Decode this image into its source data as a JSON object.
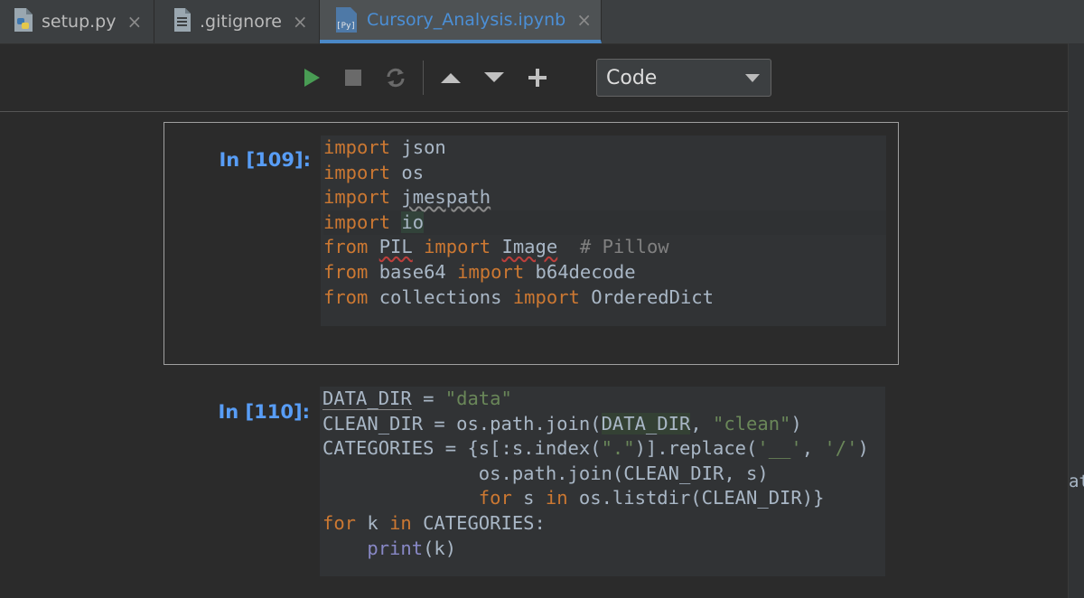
{
  "tabs": [
    {
      "label": "setup.py",
      "icon": "python-file-icon",
      "close": "×",
      "active": false
    },
    {
      "label": ".gitignore",
      "icon": "text-file-icon",
      "close": "×",
      "active": false
    },
    {
      "label": "Cursory_Analysis.ipynb",
      "icon": "notebook-file-icon",
      "icon_text": "[Py]",
      "close": "×",
      "active": true
    }
  ],
  "toolbar": {
    "cell_type": "Code",
    "buttons": [
      "run-cell-icon",
      "stop-icon",
      "restart-kernel-icon",
      "move-up-icon",
      "move-down-icon",
      "add-cell-icon"
    ],
    "run_color": "#499c54"
  },
  "cells": [
    {
      "prompt": "In [109]:",
      "lines": [
        "import json",
        "import os",
        "import jmespath",
        "import io",
        "from PIL import Image  # Pillow",
        "from base64 import b64decode",
        "from collections import OrderedDict"
      ]
    },
    {
      "prompt": "In [110]:",
      "lines": [
        "DATA_DIR = \"data\"",
        "CLEAN_DIR = os.path.join(DATA_DIR, \"clean\")",
        "CATEGORIES = {s[:s.index(\".\")].replace('__', '/')",
        "              os.path.join(CLEAN_DIR, s)",
        "              for s in os.listdir(CLEAN_DIR)}",
        "for k in CATEGORIES:",
        "    print(k)"
      ]
    }
  ],
  "right_edge_text": "at",
  "colors": {
    "background": "#2b2b2b",
    "keyword": "#cc7832",
    "string": "#6a8759",
    "comment": "#808080",
    "prompt": "#589df6",
    "active_tab_accent": "#4a88c7"
  }
}
